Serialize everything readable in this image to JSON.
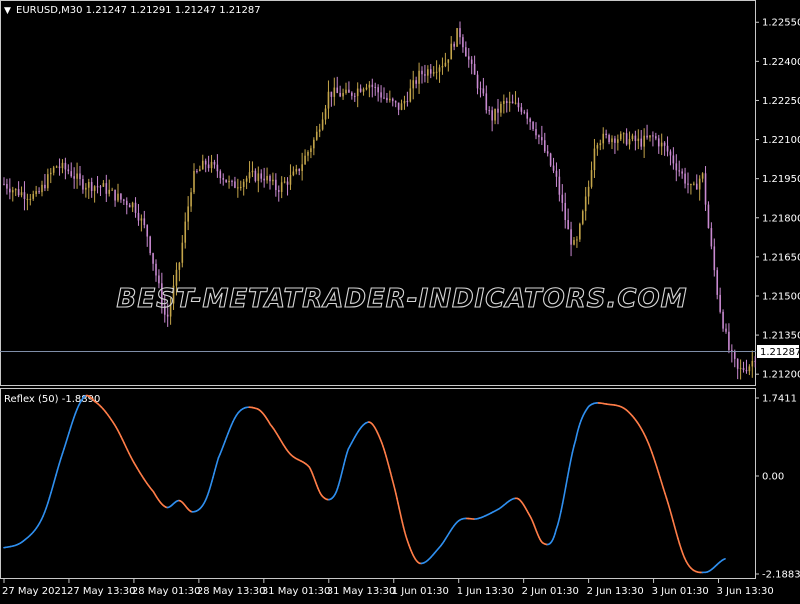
{
  "chart_data": [
    {
      "type": "candlestick",
      "title": "EURUSD,M30  1.21247 1.21291 1.21247 1.21287",
      "symbol": "EURUSD",
      "timeframe": "M30",
      "ohlc": {
        "open": 1.21247,
        "high": 1.21291,
        "low": 1.21247,
        "close": 1.21287
      },
      "ylim": [
        1.2117,
        1.2262
      ],
      "yticks": [
        "1.22550",
        "1.22400",
        "1.22250",
        "1.22100",
        "1.21950",
        "1.21800",
        "1.21650",
        "1.21500",
        "1.21350",
        "1.21200"
      ],
      "current_price_label": "1.21287",
      "current_price": 1.21287,
      "close_path": [
        {
          "t": 0.0,
          "y": 1.2193
        },
        {
          "t": 0.2,
          "y": 1.219
        },
        {
          "t": 0.5,
          "y": 1.2188
        },
        {
          "t": 0.8,
          "y": 1.22
        },
        {
          "t": 1.0,
          "y": 1.2198
        },
        {
          "t": 1.2,
          "y": 1.2193
        },
        {
          "t": 1.5,
          "y": 1.2192
        },
        {
          "t": 1.8,
          "y": 1.2187
        },
        {
          "t": 2.0,
          "y": 1.2185
        },
        {
          "t": 2.2,
          "y": 1.2174
        },
        {
          "t": 2.5,
          "y": 1.214
        },
        {
          "t": 2.7,
          "y": 1.2163
        },
        {
          "t": 2.9,
          "y": 1.2195
        },
        {
          "t": 3.1,
          "y": 1.2201
        },
        {
          "t": 3.3,
          "y": 1.2198
        },
        {
          "t": 3.5,
          "y": 1.2192
        },
        {
          "t": 3.8,
          "y": 1.2196
        },
        {
          "t": 4.0,
          "y": 1.2196
        },
        {
          "t": 4.2,
          "y": 1.2191
        },
        {
          "t": 4.5,
          "y": 1.2197
        },
        {
          "t": 4.8,
          "y": 1.2211
        },
        {
          "t": 5.0,
          "y": 1.2228
        },
        {
          "t": 5.3,
          "y": 1.2227
        },
        {
          "t": 5.6,
          "y": 1.2232
        },
        {
          "t": 5.9,
          "y": 1.2225
        },
        {
          "t": 6.1,
          "y": 1.2222
        },
        {
          "t": 6.4,
          "y": 1.2235
        },
        {
          "t": 6.8,
          "y": 1.224
        },
        {
          "t": 7.0,
          "y": 1.2252
        },
        {
          "t": 7.2,
          "y": 1.2237
        },
        {
          "t": 7.5,
          "y": 1.2218
        },
        {
          "t": 7.7,
          "y": 1.2224
        },
        {
          "t": 8.0,
          "y": 1.2222
        },
        {
          "t": 8.2,
          "y": 1.2213
        },
        {
          "t": 8.5,
          "y": 1.2195
        },
        {
          "t": 8.7,
          "y": 1.2173
        },
        {
          "t": 8.8,
          "y": 1.2168
        },
        {
          "t": 9.0,
          "y": 1.2192
        },
        {
          "t": 9.1,
          "y": 1.221
        },
        {
          "t": 9.4,
          "y": 1.2211
        },
        {
          "t": 9.8,
          "y": 1.2209
        },
        {
          "t": 10.0,
          "y": 1.2211
        },
        {
          "t": 10.2,
          "y": 1.2206
        },
        {
          "t": 10.4,
          "y": 1.2198
        },
        {
          "t": 10.6,
          "y": 1.219
        },
        {
          "t": 10.75,
          "y": 1.2197
        },
        {
          "t": 10.85,
          "y": 1.2175
        },
        {
          "t": 11.0,
          "y": 1.2148
        },
        {
          "t": 11.15,
          "y": 1.213
        },
        {
          "t": 11.3,
          "y": 1.2121
        },
        {
          "t": 11.5,
          "y": 1.2124
        },
        {
          "t": 11.6,
          "y": 1.2129
        }
      ]
    },
    {
      "type": "line",
      "title": "Reflex (50) -1.8890",
      "indicator": "Reflex",
      "period": 50,
      "current_value": -1.889,
      "ylim": [
        -2.1883,
        1.7411
      ],
      "yticks": [
        "1.7411",
        "0.00",
        "-2.1883"
      ],
      "series": [
        {
          "colors": {
            "rising": "#2f8fef",
            "falling": "#ff7d48"
          },
          "points": [
            {
              "t": 0.0,
              "y": -1.6
            },
            {
              "t": 0.3,
              "y": -1.45
            },
            {
              "t": 0.6,
              "y": -0.9
            },
            {
              "t": 0.9,
              "y": 0.5
            },
            {
              "t": 1.2,
              "y": 1.7
            },
            {
              "t": 1.4,
              "y": 1.66
            },
            {
              "t": 1.7,
              "y": 1.15
            },
            {
              "t": 2.0,
              "y": 0.3
            },
            {
              "t": 2.3,
              "y": -0.35
            },
            {
              "t": 2.5,
              "y": -0.7
            },
            {
              "t": 2.7,
              "y": -0.55
            },
            {
              "t": 2.9,
              "y": -0.8
            },
            {
              "t": 3.1,
              "y": -0.55
            },
            {
              "t": 3.3,
              "y": 0.4
            },
            {
              "t": 3.6,
              "y": 1.4
            },
            {
              "t": 3.9,
              "y": 1.5
            },
            {
              "t": 4.1,
              "y": 1.15
            },
            {
              "t": 4.4,
              "y": 0.5
            },
            {
              "t": 4.7,
              "y": 0.2
            },
            {
              "t": 4.9,
              "y": -0.45
            },
            {
              "t": 5.1,
              "y": -0.4
            },
            {
              "t": 5.3,
              "y": 0.6
            },
            {
              "t": 5.6,
              "y": 1.2
            },
            {
              "t": 5.8,
              "y": 0.8
            },
            {
              "t": 6.0,
              "y": -0.2
            },
            {
              "t": 6.2,
              "y": -1.4
            },
            {
              "t": 6.4,
              "y": -1.95
            },
            {
              "t": 6.7,
              "y": -1.6
            },
            {
              "t": 7.0,
              "y": -1.0
            },
            {
              "t": 7.3,
              "y": -0.95
            },
            {
              "t": 7.6,
              "y": -0.75
            },
            {
              "t": 7.9,
              "y": -0.5
            },
            {
              "t": 8.1,
              "y": -0.9
            },
            {
              "t": 8.3,
              "y": -1.5
            },
            {
              "t": 8.5,
              "y": -1.2
            },
            {
              "t": 8.8,
              "y": 0.8
            },
            {
              "t": 9.0,
              "y": 1.55
            },
            {
              "t": 9.3,
              "y": 1.6
            },
            {
              "t": 9.6,
              "y": 1.45
            },
            {
              "t": 9.9,
              "y": 0.8
            },
            {
              "t": 10.2,
              "y": -0.5
            },
            {
              "t": 10.5,
              "y": -1.9
            },
            {
              "t": 10.8,
              "y": -2.15
            },
            {
              "t": 11.1,
              "y": -1.85
            }
          ]
        }
      ]
    }
  ],
  "time_axis": {
    "labels": [
      "27 May 2021",
      "27 May 13:30",
      "28 May 01:30",
      "28 May 13:30",
      "31 May 01:30",
      "31 May 13:30",
      "1 Jun 01:30",
      "1 Jun 13:30",
      "2 Jun 01:30",
      "2 Jun 13:30",
      "3 Jun 01:30",
      "3 Jun 13:30"
    ]
  },
  "watermark": "BEST-METATRADER-INDICATORS.COM",
  "colors": {
    "background": "#000000",
    "grid_frame": "#c8c8c8",
    "candle_up": "#c4a54a",
    "candle_down": "#c98ad1",
    "price_line": "#7f8ea8",
    "reflex_up": "#2f8fef",
    "reflex_down": "#ff7d48"
  }
}
